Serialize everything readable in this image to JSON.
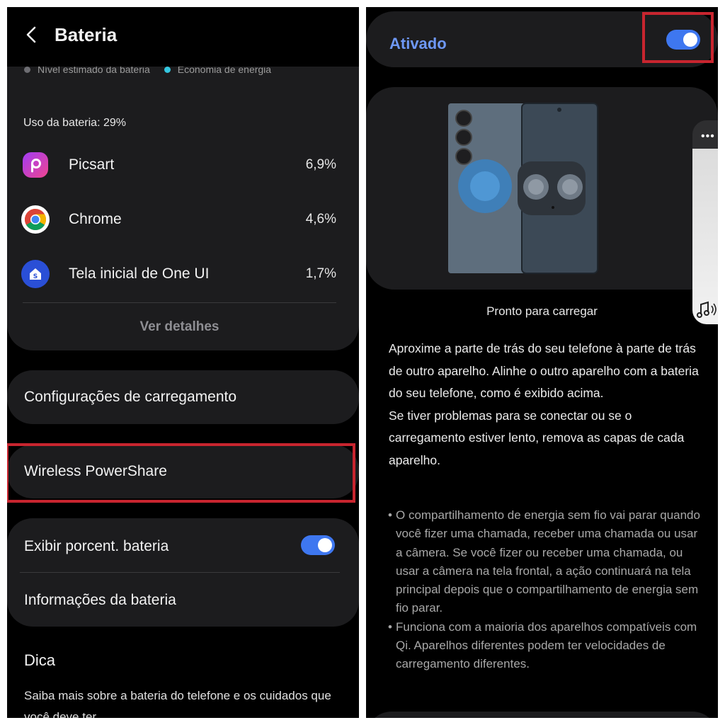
{
  "left": {
    "header": {
      "title": "Bateria"
    },
    "legend": [
      {
        "label": "Nível estimado da bateria",
        "color": "#6d6d72"
      },
      {
        "label": "Economia de energia",
        "color": "#34c7e0"
      }
    ],
    "usage": {
      "title": "Uso da bateria: 29%",
      "apps": [
        {
          "name": "Picsart",
          "percent": "6,9%",
          "icon": "picsart-icon"
        },
        {
          "name": "Chrome",
          "percent": "4,6%",
          "icon": "chrome-icon"
        },
        {
          "name": "Tela inicial de One UI",
          "percent": "1,7%",
          "icon": "one-ui-home-icon"
        }
      ],
      "details_label": "Ver detalhes"
    },
    "charging_settings": "Configurações de carregamento",
    "wireless_powershare": "Wireless PowerShare",
    "show_percent": {
      "label": "Exibir porcent. bateria",
      "enabled": true
    },
    "battery_info": "Informações da bateria",
    "tip": {
      "title": "Dica",
      "text": "Saiba mais sobre a bateria do telefone e os cuidados que você deve ter"
    }
  },
  "right": {
    "status": {
      "label": "Ativado",
      "enabled": true
    },
    "ready_text": "Pronto para carregar",
    "description": [
      "Aproxime a parte de trás do seu telefone à parte de trás de outro aparelho. Alinhe o outro aparelho com a bateria do seu telefone, como é exibido acima.",
      "Se tiver problemas para se conectar ou se o carregamento estiver lento, remova as capas de cada aparelho."
    ],
    "bullets": [
      "O compartilhamento de energia sem fio vai parar quando você fizer uma chamada, receber uma chamada ou usar a câmera. Se você fizer ou receber uma chamada, ou usar a câmera na tela frontal, a ação continuará na tela principal depois que o compartilhamento de energia sem fio parar.",
      "Funciona com a maioria dos aparelhos compatíveis com Qi. Aparelhos diferentes podem ter velocidades de carregamento diferentes."
    ],
    "side_panel": {
      "menu_label": "•••",
      "icon": "music-note-icon"
    }
  },
  "colors": {
    "accent_toggle": "#3e77f0",
    "highlight_box": "#c8252f",
    "status_text": "#6e98f5",
    "card": "#1c1c1e"
  }
}
